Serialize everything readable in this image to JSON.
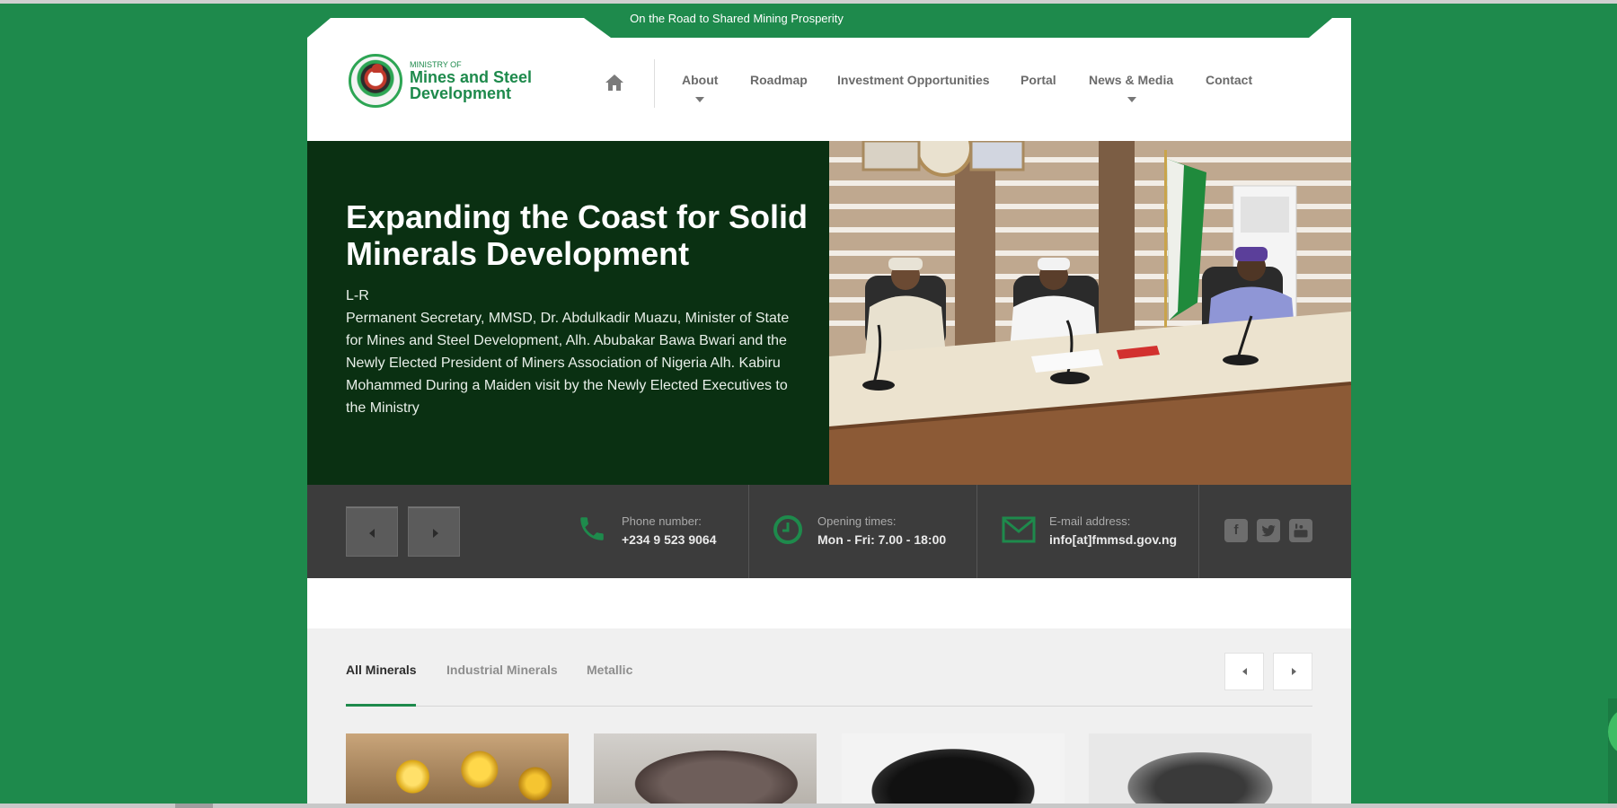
{
  "tagline": "On the Road to Shared Mining Prosperity",
  "logo": {
    "line1": "MINISTRY OF",
    "line2": "Mines and Steel",
    "line3": "Development"
  },
  "nav": {
    "home_icon": "home-icon",
    "items": [
      {
        "label": "About",
        "has_dropdown": true
      },
      {
        "label": "Roadmap",
        "has_dropdown": false
      },
      {
        "label": "Investment Opportunities",
        "has_dropdown": false
      },
      {
        "label": "Portal",
        "has_dropdown": false
      },
      {
        "label": "News & Media",
        "has_dropdown": true
      },
      {
        "label": "Contact",
        "has_dropdown": false
      }
    ]
  },
  "hero": {
    "title": "Expanding the Coast for Solid Minerals Development",
    "caption": "L-R\nPermanent Secretary, MMSD, Dr. Abdulkadir Muazu, Minister of State for Mines and Steel Development, Alh. Abubakar Bawa Bwari and the Newly Elected President of Miners Association of Nigeria Alh. Kabiru Mohammed During a Maiden visit by the Newly Elected Executives to the Ministry"
  },
  "info": {
    "phone": {
      "label": "Phone number:",
      "value": "+234 9 523 9064",
      "icon": "phone-icon"
    },
    "hours": {
      "label": "Opening times:",
      "value": "Mon - Fri: 7.00 - 18:00",
      "icon": "clock-icon"
    },
    "email": {
      "label": "E-mail address:",
      "value": "info[at]fmmsd.gov.ng",
      "icon": "envelope-icon"
    },
    "social": [
      "facebook-icon",
      "twitter-icon",
      "youtube-icon"
    ]
  },
  "minerals": {
    "tabs": [
      "All Minerals",
      "Industrial Minerals",
      "Metallic"
    ],
    "active_tab": "All Minerals"
  },
  "colors": {
    "brand_green": "#1e8a4c",
    "hero_dark": "#0a3012",
    "info_bar": "#3c3c3c"
  }
}
